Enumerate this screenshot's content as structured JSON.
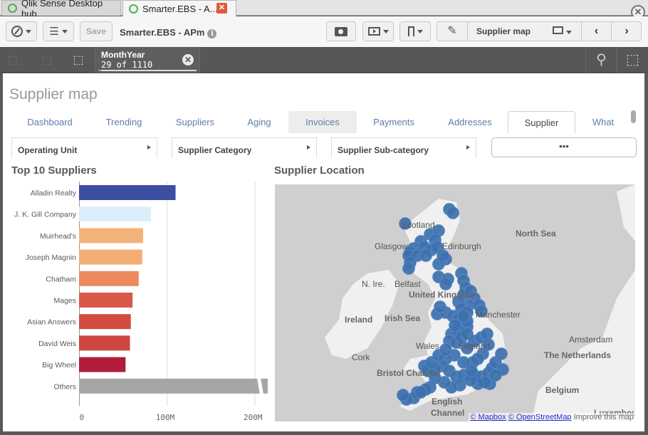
{
  "browser_tabs": [
    {
      "label": "Qlik Sense Desktop hub",
      "active": false
    },
    {
      "label": "Smarter.EBS - A...",
      "active": true
    }
  ],
  "toolbar": {
    "save_label": "Save",
    "app_title": "Smarter.EBS - APm",
    "sheet_name": "Supplier map"
  },
  "selection": {
    "field": "MonthYear",
    "count": "29 of 1110",
    "fraction": 0.026
  },
  "sheet": {
    "title": "Supplier map",
    "tabs": [
      {
        "label": "Dashboard"
      },
      {
        "label": "Trending"
      },
      {
        "label": "Suppliers"
      },
      {
        "label": "Aging"
      },
      {
        "label": "Invoices"
      },
      {
        "label": "Payments"
      },
      {
        "label": "Addresses"
      },
      {
        "label": "Supplier"
      },
      {
        "label": "What"
      }
    ],
    "active_tab": "Supplier",
    "filters": [
      {
        "label": "Operating Unit"
      },
      {
        "label": "Supplier Category"
      },
      {
        "label": "Supplier Sub-category"
      }
    ],
    "more_label": "•••",
    "bar_chart_title": "Top 10 Suppliers",
    "map_title": "Supplier Location"
  },
  "chart_data": {
    "type": "bar",
    "orientation": "horizontal",
    "title": "Top 10 Suppliers",
    "categories": [
      "Alladin Realty",
      "J. K. Gill Company",
      "Muirhead's",
      "Joseph Magnin",
      "Chatham",
      "Mages",
      "Asian Answers",
      "David Weis",
      "Big Wheel",
      "Others"
    ],
    "values": [
      110,
      82,
      73,
      72,
      68,
      61,
      59,
      58,
      53,
      240
    ],
    "colors": [
      "#3a4fa0",
      "#dbeefa",
      "#f4b378",
      "#f4ad72",
      "#ec8a5e",
      "#d9584a",
      "#d24c40",
      "#cd4640",
      "#b01c3a",
      "#a6a6a6"
    ],
    "unit": "M",
    "xlim": [
      0,
      215
    ],
    "xticks": [
      "0",
      "100M",
      "200M"
    ],
    "xtick_values": [
      0,
      100,
      200
    ],
    "truncated_bar": "Others",
    "grid": true
  },
  "map": {
    "labels": [
      {
        "text": "Scotland",
        "bold": false
      },
      {
        "text": "Glasgow",
        "bold": false
      },
      {
        "text": "Edinburgh",
        "bold": false
      },
      {
        "text": "North Sea",
        "bold": true
      },
      {
        "text": "N. Ire.",
        "bold": false
      },
      {
        "text": "Belfast",
        "bold": false
      },
      {
        "text": "United Kingdom",
        "bold": true
      },
      {
        "text": "Ireland",
        "bold": true
      },
      {
        "text": "Irish Sea",
        "bold": true
      },
      {
        "text": "Manchester",
        "bold": false
      },
      {
        "text": "Wales",
        "bold": false
      },
      {
        "text": "England",
        "bold": false
      },
      {
        "text": "Cork",
        "bold": false
      },
      {
        "text": "Amsterdam",
        "bold": false
      },
      {
        "text": "The Netherlands",
        "bold": true
      },
      {
        "text": "Bristol Channel",
        "bold": true
      },
      {
        "text": "Belgium",
        "bold": true
      },
      {
        "text": "English Channel",
        "bold": true
      },
      {
        "text": "Luxembourg",
        "bold": true
      }
    ],
    "attribution": {
      "mapbox": "© Mapbox",
      "osm": "© OpenStreetMap",
      "improve": "Improve this map"
    },
    "point_color": "#3d70ae"
  }
}
